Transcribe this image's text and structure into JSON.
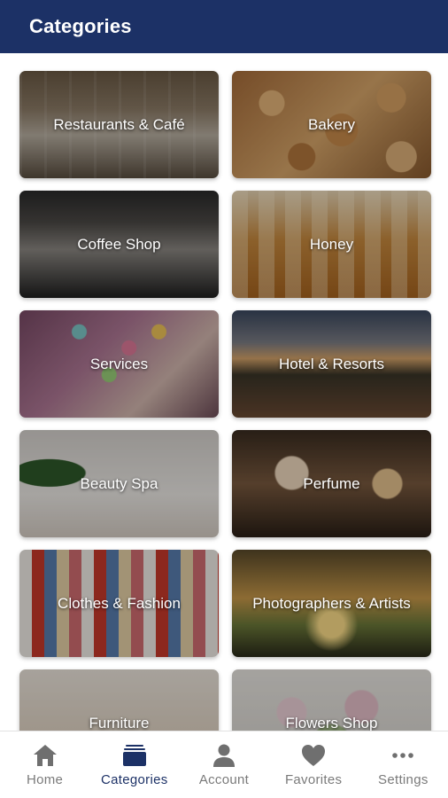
{
  "header": {
    "title": "Categories"
  },
  "categories": [
    {
      "label": "Restaurants & Café"
    },
    {
      "label": "Bakery"
    },
    {
      "label": "Coffee Shop"
    },
    {
      "label": "Honey"
    },
    {
      "label": "Services"
    },
    {
      "label": "Hotel & Resorts"
    },
    {
      "label": "Beauty Spa"
    },
    {
      "label": "Perfume"
    },
    {
      "label": "Clothes & Fashion"
    },
    {
      "label": "Photographers & Artists"
    },
    {
      "label": "Furniture"
    },
    {
      "label": "Flowers Shop"
    }
  ],
  "bottom_nav": {
    "active": "Categories",
    "items": [
      {
        "label": "Home",
        "icon": "home-icon"
      },
      {
        "label": "Categories",
        "icon": "categories-icon"
      },
      {
        "label": "Account",
        "icon": "account-icon"
      },
      {
        "label": "Favorites",
        "icon": "heart-icon"
      },
      {
        "label": "Settings",
        "icon": "more-icon"
      }
    ]
  },
  "colors": {
    "app_bar": "#1c3166",
    "active_nav": "#1c3166",
    "inactive_nav": "#7a7a7a"
  }
}
